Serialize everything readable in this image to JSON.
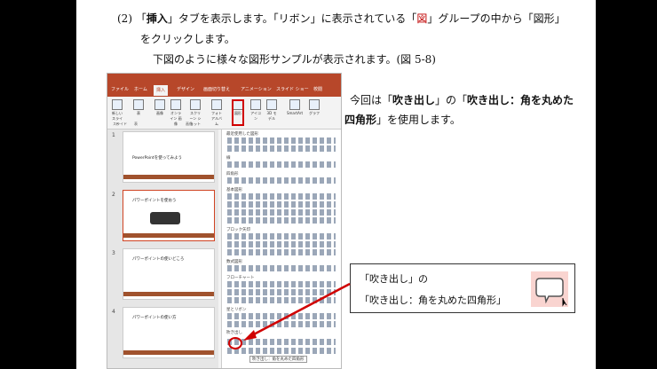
{
  "doc": {
    "line1_num": "(2)",
    "line1_a": "「",
    "line1_insert": "挿入",
    "line1_b": "」タブを表示します。「リボン」に表示されている「",
    "line1_fig": "図",
    "line1_c": "」グループの中から「図形」",
    "line2": "をクリックします。",
    "line3": "下図のように様々な図形サンプルが表示されます。(図 5-8)",
    "side_a": "今回は「",
    "side_b": "吹き出し",
    "side_c": "」の「",
    "side_d": "吹き出し：角を丸めた",
    "side_e": "四角形",
    "side_f": "」を使用します。"
  },
  "annotation": {
    "line1": "「吹き出し」の",
    "line2": "「吹き出し：角を丸めた四角形」",
    "icon": "rounded-rect-callout-icon"
  },
  "ppt": {
    "tabs": [
      "ファイル",
      "ホーム",
      "挿入",
      "デザイン",
      "画面切り替え",
      "アニメーション",
      "スライド ショー",
      "校閲"
    ],
    "active_tab": "挿入",
    "ribbon_buttons": [
      "新しい スライド",
      "表",
      "画像",
      "オンライン 画像",
      "スクリーン ショット",
      "フォト アルバム",
      "図形",
      "アイコン",
      "3D モデル",
      "SmartArt",
      "グラフ"
    ],
    "groups": [
      "スライド",
      "表",
      "画像"
    ],
    "gallery_headers": [
      "最近使用した図形",
      "線",
      "四角形",
      "基本図形",
      "ブロック矢印",
      "数式図形",
      "フローチャート",
      "星とリボン",
      "吹き出し"
    ],
    "slides": [
      {
        "num": "1",
        "title": "PowerPointを使ってみよう"
      },
      {
        "num": "2",
        "title": "パワーポイントを使おう"
      },
      {
        "num": "3",
        "title": "パワーポイントの使いどころ"
      },
      {
        "num": "4",
        "title": "パワーポイントの使い方"
      }
    ],
    "tooltip": "吹き出し：角を丸めた四角形",
    "accent": "#b7472a"
  }
}
